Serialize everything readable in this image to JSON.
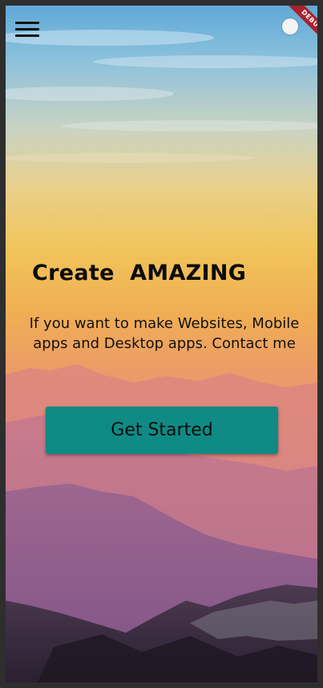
{
  "app": {
    "debug_banner": "DEBUG",
    "accent_color": "#0f8a84"
  },
  "header": {
    "menu_icon": "hamburger-menu-icon",
    "theme_toggle_icon": "circle-toggle-icon"
  },
  "hero": {
    "headline": "Create  AMAZING",
    "subtext": "If you want to make Websites, Mobile apps and Desktop apps. Contact me",
    "cta_label": "Get Started"
  }
}
